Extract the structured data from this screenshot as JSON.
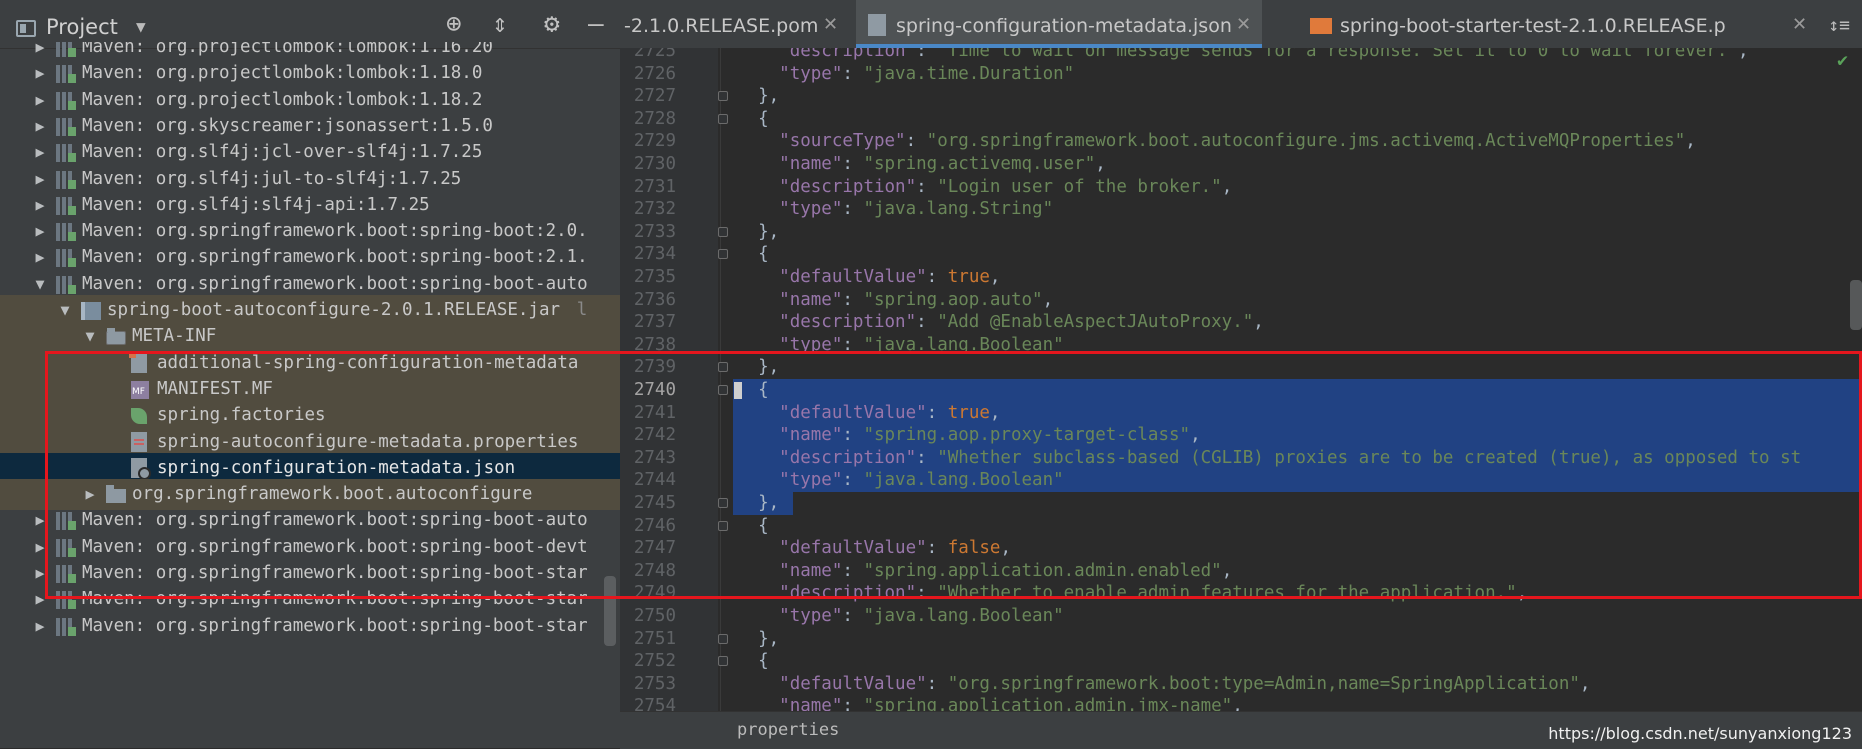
{
  "project_panel": {
    "title": "Project",
    "tree": [
      {
        "label": "Maven: org.projectlombok:lombok:1.16.20",
        "icon": "library-icon",
        "expanded": false
      },
      {
        "label": "Maven: org.projectlombok:lombok:1.18.0",
        "icon": "library-icon",
        "expanded": false
      },
      {
        "label": "Maven: org.projectlombok:lombok:1.18.2",
        "icon": "library-icon",
        "expanded": false
      },
      {
        "label": "Maven: org.skyscreamer:jsonassert:1.5.0",
        "icon": "library-icon",
        "expanded": false
      },
      {
        "label": "Maven: org.slf4j:jcl-over-slf4j:1.7.25",
        "icon": "library-icon",
        "expanded": false
      },
      {
        "label": "Maven: org.slf4j:jul-to-slf4j:1.7.25",
        "icon": "library-icon",
        "expanded": false
      },
      {
        "label": "Maven: org.slf4j:slf4j-api:1.7.25",
        "icon": "library-icon",
        "expanded": false
      },
      {
        "label": "Maven: org.springframework.boot:spring-boot:2.0.",
        "icon": "library-icon",
        "expanded": false
      },
      {
        "label": "Maven: org.springframework.boot:spring-boot:2.1.",
        "icon": "library-icon",
        "expanded": false
      },
      {
        "label": "Maven: org.springframework.boot:spring-boot-auto",
        "icon": "library-icon",
        "expanded": true
      },
      {
        "label": "spring-boot-autoconfigure-2.0.1.RELEASE.jar",
        "suffix": "l",
        "icon": "jar-icon",
        "expanded": true
      },
      {
        "label": "META-INF",
        "icon": "folder-icon",
        "expanded": true
      },
      {
        "label": "additional-spring-configuration-metadata",
        "icon": "json-file-icon"
      },
      {
        "label": "MANIFEST.MF",
        "icon": "manifest-icon"
      },
      {
        "label": "spring.factories",
        "icon": "spring-leaf-icon"
      },
      {
        "label": "spring-autoconfigure-metadata.properties",
        "icon": "properties-file-icon"
      },
      {
        "label": "spring-configuration-metadata.json",
        "icon": "json-file-icon",
        "selected": true
      },
      {
        "label": "org.springframework.boot.autoconfigure",
        "icon": "package-icon",
        "expanded": false
      },
      {
        "label": "Maven: org.springframework.boot:spring-boot-auto",
        "icon": "library-icon",
        "expanded": false
      },
      {
        "label": "Maven: org.springframework.boot:spring-boot-devt",
        "icon": "library-icon",
        "expanded": false
      },
      {
        "label": "Maven: org.springframework.boot:spring-boot-star",
        "icon": "library-icon",
        "expanded": false
      },
      {
        "label": "Maven: org.springframework.boot:spring-boot-star",
        "icon": "library-icon",
        "expanded": false
      },
      {
        "label": "Maven: org.springframework.boot:spring-boot-star",
        "icon": "library-icon",
        "expanded": false
      }
    ]
  },
  "tabs": [
    {
      "label": "-2.1.0.RELEASE.pom",
      "active": false
    },
    {
      "label": "spring-configuration-metadata.json",
      "active": true
    },
    {
      "label": "spring-boot-starter-test-2.1.0.RELEASE.p",
      "active": false
    }
  ],
  "editor": {
    "current_line": 2740,
    "lines": [
      {
        "n": 2725,
        "tokens": [
          [
            "p",
            "    "
          ],
          [
            "k",
            "\"description\""
          ],
          [
            "p",
            ": "
          ],
          [
            "s",
            "\"Time to wait on message sends for a response. Set it to 0 to wait forever.\""
          ],
          [
            "p",
            ","
          ]
        ]
      },
      {
        "n": 2726,
        "tokens": [
          [
            "p",
            "    "
          ],
          [
            "k",
            "\"type\""
          ],
          [
            "p",
            ": "
          ],
          [
            "s",
            "\"java.time.Duration\""
          ]
        ]
      },
      {
        "n": 2727,
        "tokens": [
          [
            "p",
            "  },"
          ]
        ]
      },
      {
        "n": 2728,
        "tokens": [
          [
            "p",
            "  {"
          ]
        ]
      },
      {
        "n": 2729,
        "tokens": [
          [
            "p",
            "    "
          ],
          [
            "k",
            "\"sourceType\""
          ],
          [
            "p",
            ": "
          ],
          [
            "s",
            "\"org.springframework.boot.autoconfigure.jms.activemq.ActiveMQProperties\""
          ],
          [
            "p",
            ","
          ]
        ]
      },
      {
        "n": 2730,
        "tokens": [
          [
            "p",
            "    "
          ],
          [
            "k",
            "\"name\""
          ],
          [
            "p",
            ": "
          ],
          [
            "s",
            "\"spring.activemq.user\""
          ],
          [
            "p",
            ","
          ]
        ]
      },
      {
        "n": 2731,
        "tokens": [
          [
            "p",
            "    "
          ],
          [
            "k",
            "\"description\""
          ],
          [
            "p",
            ": "
          ],
          [
            "s",
            "\"Login user of the broker.\""
          ],
          [
            "p",
            ","
          ]
        ]
      },
      {
        "n": 2732,
        "tokens": [
          [
            "p",
            "    "
          ],
          [
            "k",
            "\"type\""
          ],
          [
            "p",
            ": "
          ],
          [
            "s",
            "\"java.lang.String\""
          ]
        ]
      },
      {
        "n": 2733,
        "tokens": [
          [
            "p",
            "  },"
          ]
        ]
      },
      {
        "n": 2734,
        "tokens": [
          [
            "p",
            "  {"
          ]
        ]
      },
      {
        "n": 2735,
        "tokens": [
          [
            "p",
            "    "
          ],
          [
            "k",
            "\"defaultValue\""
          ],
          [
            "p",
            ": "
          ],
          [
            "kw",
            "true"
          ],
          [
            "p",
            ","
          ]
        ]
      },
      {
        "n": 2736,
        "tokens": [
          [
            "p",
            "    "
          ],
          [
            "k",
            "\"name\""
          ],
          [
            "p",
            ": "
          ],
          [
            "s",
            "\"spring.aop.auto\""
          ],
          [
            "p",
            ","
          ]
        ]
      },
      {
        "n": 2737,
        "tokens": [
          [
            "p",
            "    "
          ],
          [
            "k",
            "\"description\""
          ],
          [
            "p",
            ": "
          ],
          [
            "s",
            "\"Add @EnableAspectJAutoProxy.\""
          ],
          [
            "p",
            ","
          ]
        ]
      },
      {
        "n": 2738,
        "tokens": [
          [
            "p",
            "    "
          ],
          [
            "k",
            "\"type\""
          ],
          [
            "p",
            ": "
          ],
          [
            "s",
            "\"java.lang.Boolean\""
          ]
        ]
      },
      {
        "n": 2739,
        "tokens": [
          [
            "p",
            "  },"
          ]
        ]
      },
      {
        "n": 2740,
        "tokens": [
          [
            "p",
            "  {"
          ]
        ],
        "selected": true
      },
      {
        "n": 2741,
        "tokens": [
          [
            "p",
            "    "
          ],
          [
            "k",
            "\"defaultValue\""
          ],
          [
            "p",
            ": "
          ],
          [
            "kw",
            "true"
          ],
          [
            "p",
            ","
          ]
        ],
        "selected": true
      },
      {
        "n": 2742,
        "tokens": [
          [
            "p",
            "    "
          ],
          [
            "k",
            "\"name\""
          ],
          [
            "p",
            ": "
          ],
          [
            "s",
            "\"spring.aop.proxy-target-class\""
          ],
          [
            "p",
            ","
          ]
        ],
        "selected": true
      },
      {
        "n": 2743,
        "tokens": [
          [
            "p",
            "    "
          ],
          [
            "k",
            "\"description\""
          ],
          [
            "p",
            ": "
          ],
          [
            "s",
            "\"Whether subclass-based (CGLIB) proxies are to be created (true), as opposed to st"
          ]
        ],
        "selected": true
      },
      {
        "n": 2744,
        "tokens": [
          [
            "p",
            "    "
          ],
          [
            "k",
            "\"type\""
          ],
          [
            "p",
            ": "
          ],
          [
            "s",
            "\"java.lang.Boolean\""
          ]
        ],
        "selected": true
      },
      {
        "n": 2745,
        "tokens": [
          [
            "p",
            "  },"
          ]
        ],
        "selected": true,
        "partial": true
      },
      {
        "n": 2746,
        "tokens": [
          [
            "p",
            "  {"
          ]
        ]
      },
      {
        "n": 2747,
        "tokens": [
          [
            "p",
            "    "
          ],
          [
            "k",
            "\"defaultValue\""
          ],
          [
            "p",
            ": "
          ],
          [
            "kw",
            "false"
          ],
          [
            "p",
            ","
          ]
        ]
      },
      {
        "n": 2748,
        "tokens": [
          [
            "p",
            "    "
          ],
          [
            "k",
            "\"name\""
          ],
          [
            "p",
            ": "
          ],
          [
            "s",
            "\"spring.application.admin.enabled\""
          ],
          [
            "p",
            ","
          ]
        ]
      },
      {
        "n": 2749,
        "tokens": [
          [
            "p",
            "    "
          ],
          [
            "k",
            "\"description\""
          ],
          [
            "p",
            ": "
          ],
          [
            "s",
            "\"Whether to enable admin features for the application.\""
          ],
          [
            "p",
            ","
          ]
        ]
      },
      {
        "n": 2750,
        "tokens": [
          [
            "p",
            "    "
          ],
          [
            "k",
            "\"type\""
          ],
          [
            "p",
            ": "
          ],
          [
            "s",
            "\"java.lang.Boolean\""
          ]
        ]
      },
      {
        "n": 2751,
        "tokens": [
          [
            "p",
            "  },"
          ]
        ]
      },
      {
        "n": 2752,
        "tokens": [
          [
            "p",
            "  {"
          ]
        ]
      },
      {
        "n": 2753,
        "tokens": [
          [
            "p",
            "    "
          ],
          [
            "k",
            "\"defaultValue\""
          ],
          [
            "p",
            ": "
          ],
          [
            "s",
            "\"org.springframework.boot:type=Admin,name=SpringApplication\""
          ],
          [
            "p",
            ","
          ]
        ]
      },
      {
        "n": 2754,
        "tokens": [
          [
            "p",
            "    "
          ],
          [
            "k",
            "\"name\""
          ],
          [
            "p",
            ": "
          ],
          [
            "s",
            "\"spring.application.admin.jmx-name\""
          ],
          [
            "p",
            ","
          ]
        ]
      }
    ]
  },
  "breadcrumb": "properties",
  "watermark": "https://blog.csdn.net/sunyanxiong123",
  "colors": {
    "key": "#9876aa",
    "string": "#6a8759",
    "keyword": "#cc7832",
    "selection": "#214283",
    "highlight_box": "#e5161d"
  }
}
